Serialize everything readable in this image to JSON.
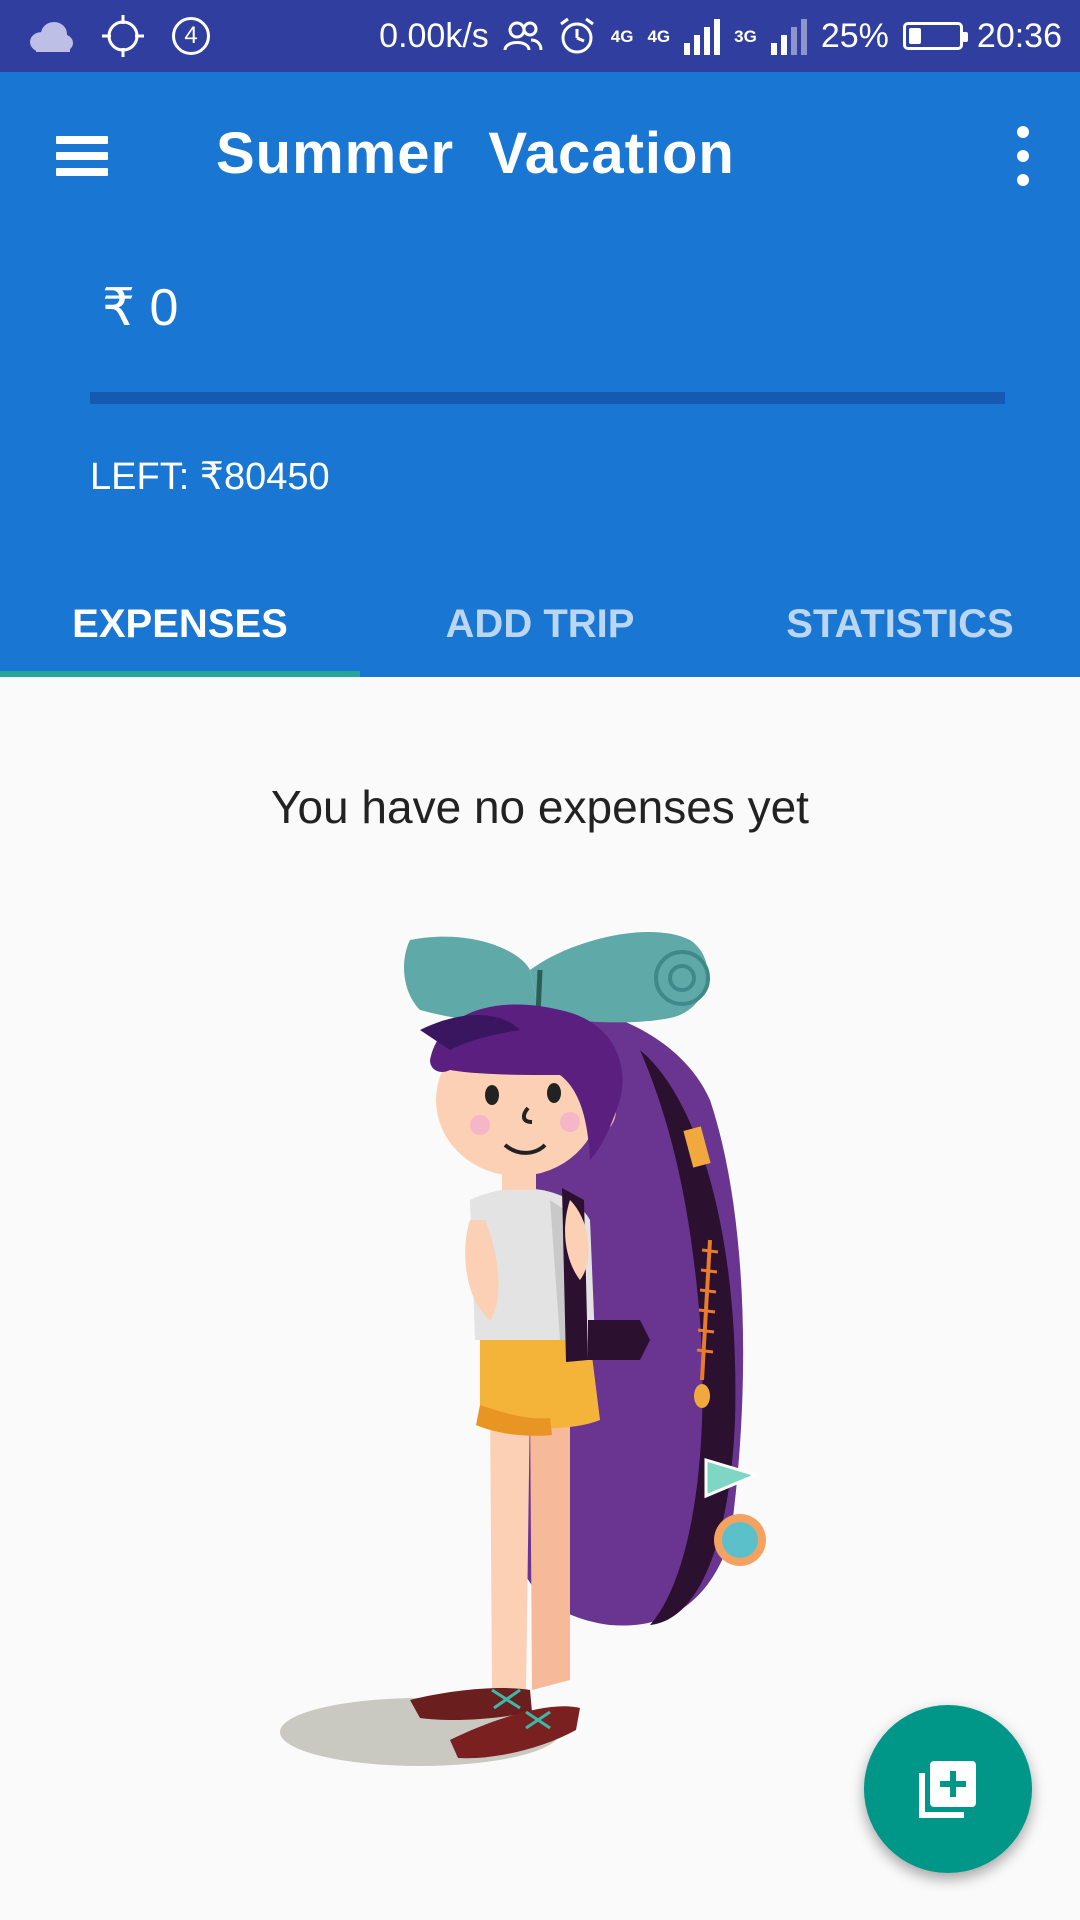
{
  "status_bar": {
    "notification_count": "4",
    "net_speed": "0.00k/s",
    "net_4g_a": "4G",
    "net_4g_b": "4G",
    "net_3g": "3G",
    "battery_percent": "25%",
    "battery_level": 0.25,
    "time": "20:36"
  },
  "app_bar": {
    "title": "Summer  Vacation",
    "amount": "₹ 0",
    "left_label": "LEFT: ₹80450"
  },
  "tabs": [
    {
      "label": "EXPENSES",
      "active": true
    },
    {
      "label": "ADD TRIP",
      "active": false
    },
    {
      "label": "STATISTICS",
      "active": false
    }
  ],
  "content": {
    "empty_message": "You have no expenses yet"
  },
  "icons": {
    "menu": "hamburger-icon",
    "more": "more-vert-icon",
    "fab": "add-expense-icon"
  },
  "colors": {
    "primary": "#1976d2",
    "status_bar": "#303f9f",
    "accent": "#009688"
  }
}
